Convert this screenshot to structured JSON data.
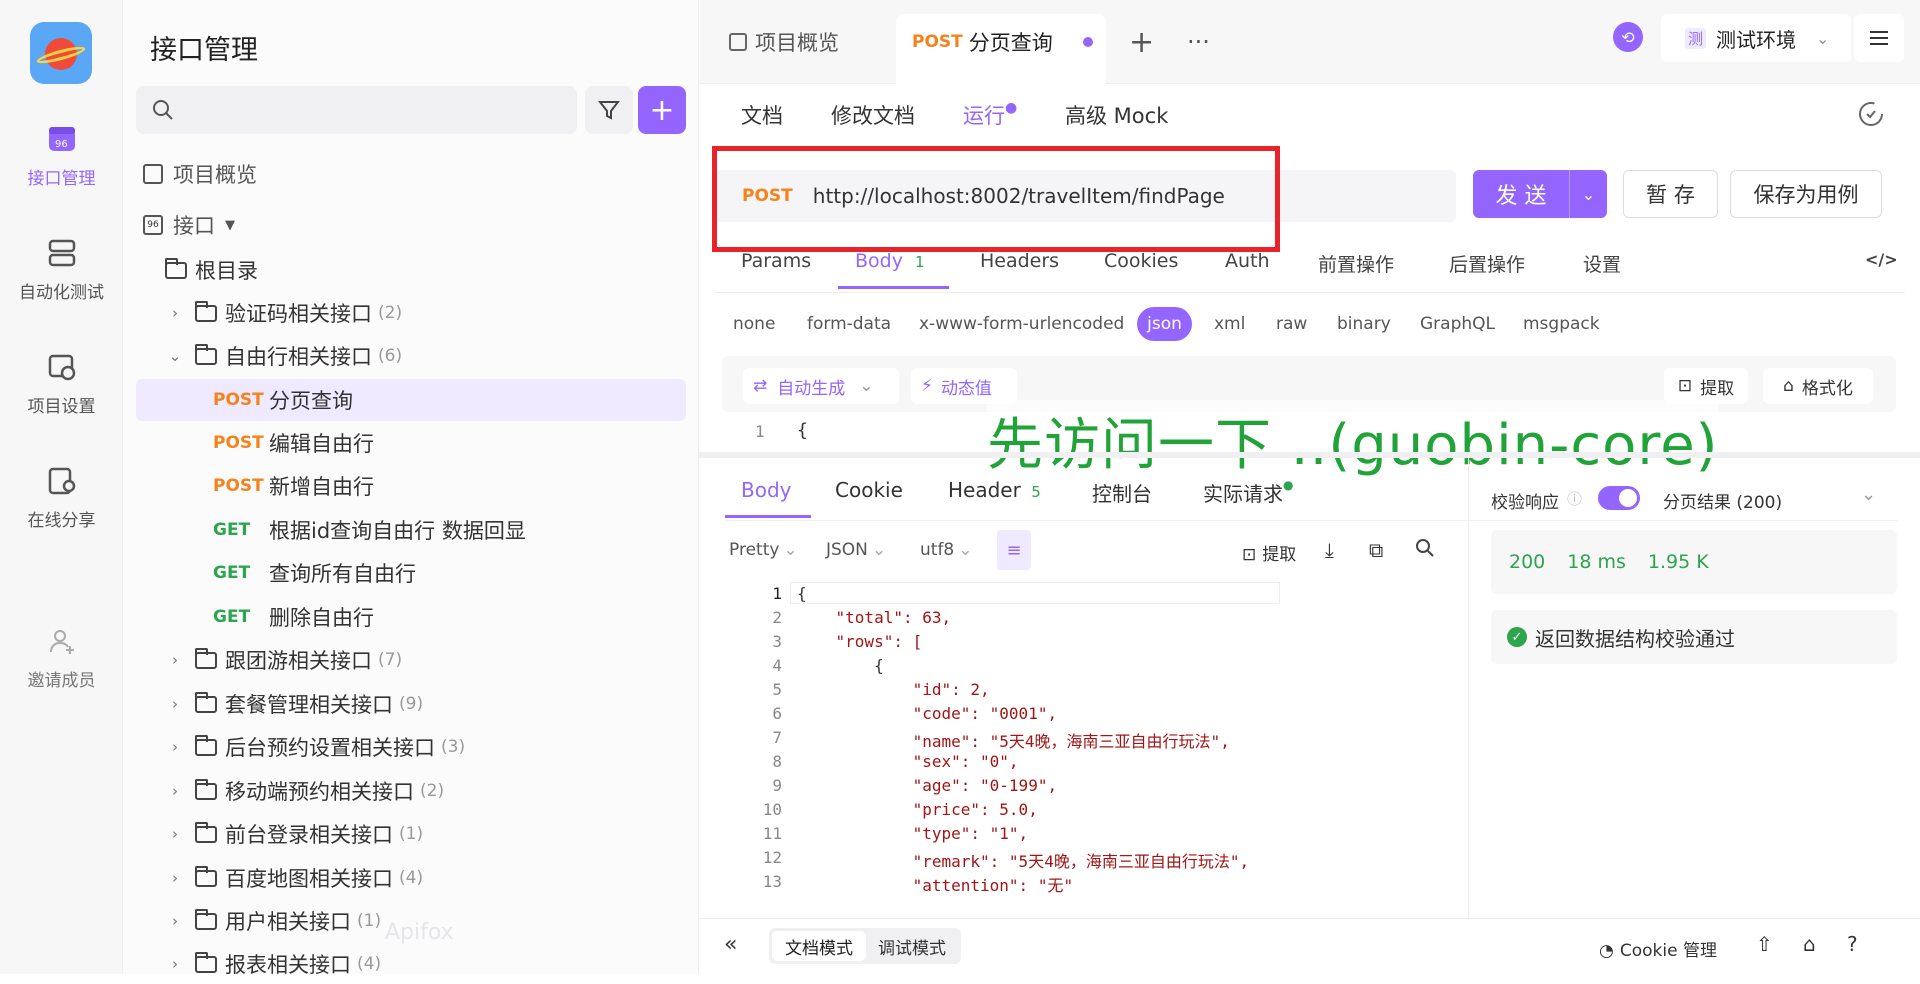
{
  "rail": {
    "items": [
      {
        "label": "接口管理",
        "icon": "api-icon",
        "active": true
      },
      {
        "label": "自动化测试",
        "icon": "automation-icon"
      },
      {
        "label": "项目设置",
        "icon": "settings-icon"
      },
      {
        "label": "在线分享",
        "icon": "share-icon"
      },
      {
        "label": "邀请成员",
        "icon": "add-user-icon"
      }
    ]
  },
  "sidebar": {
    "title": "接口管理",
    "overview": "项目概览",
    "interface": "接口",
    "root": "根目录",
    "folders": [
      {
        "name": "验证码相关接口",
        "count": "(2)"
      },
      {
        "name": "自由行相关接口",
        "count": "(6)"
      },
      {
        "name": "跟团游相关接口",
        "count": "(7)"
      },
      {
        "name": "套餐管理相关接口",
        "count": "(9)"
      },
      {
        "name": "后台预约设置相关接口",
        "count": "(3)"
      },
      {
        "name": "移动端预约相关接口",
        "count": "(2)"
      },
      {
        "name": "前台登录相关接口",
        "count": "(1)"
      },
      {
        "name": "百度地图相关接口",
        "count": "(4)"
      },
      {
        "name": "用户相关接口",
        "count": "(1)"
      },
      {
        "name": "报表相关接口",
        "count": "(4)"
      }
    ],
    "endpoints": [
      {
        "method": "POST",
        "name": "分页查询"
      },
      {
        "method": "POST",
        "name": "编辑自由行"
      },
      {
        "method": "POST",
        "name": "新增自由行"
      },
      {
        "method": "GET",
        "name": "根据id查询自由行 数据回显"
      },
      {
        "method": "GET",
        "name": "查询所有自由行"
      },
      {
        "method": "GET",
        "name": "删除自由行"
      }
    ],
    "watermark": "Apifox"
  },
  "topbar": {
    "tab1": "项目概览",
    "tab2_method": "POST",
    "tab2_name": "分页查询",
    "env_badge": "测",
    "env_name": "测试环境"
  },
  "subtabs": {
    "doc": "文档",
    "edit": "修改文档",
    "run": "运行",
    "mock": "高级 Mock"
  },
  "request": {
    "method": "POST",
    "url": "http://localhost:8002/travelItem/findPage",
    "send": "发 送",
    "save": "暂 存",
    "save_case": "保存为用例"
  },
  "body_tabs": [
    "Params",
    "Body",
    "Headers",
    "Cookies",
    "Auth",
    "前置操作",
    "后置操作",
    "设置"
  ],
  "body_count": "1",
  "content_types": [
    "none",
    "form-data",
    "x-www-form-urlencoded",
    "json",
    "xml",
    "raw",
    "binary",
    "GraphQL",
    "msgpack"
  ],
  "editor_tools": {
    "auto": "自动生成",
    "dynamic": "动态值",
    "extract": "提取",
    "format": "格式化",
    "first_line": "{"
  },
  "overlay": "先访问一下 ..(guobin-core)",
  "response": {
    "tabs": [
      "Body",
      "Cookie",
      "Header",
      "控制台",
      "实际请求"
    ],
    "header_count": "5",
    "pretty": "Pretty",
    "json": "JSON",
    "enc": "utf8",
    "extract": "提取",
    "lines": [
      "{",
      "    \"total\": 63,",
      "    \"rows\": [",
      "        {",
      "            \"id\": 2,",
      "            \"code\": \"0001\",",
      "            \"name\": \"5天4晚，海南三亚自由行玩法\",",
      "            \"sex\": \"0\",",
      "            \"age\": \"0-199\",",
      "            \"price\": 5.0,",
      "            \"type\": \"1\",",
      "            \"remark\": \"5天4晚，海南三亚自由行玩法\",",
      "            \"attention\": \"无\""
    ]
  },
  "validation": {
    "label": "校验响应",
    "result": "分页结果 (200)",
    "status": "200",
    "time": "18 ms",
    "size": "1.95 K",
    "message": "返回数据结构校验通过"
  },
  "footer": {
    "doc_mode": "文档模式",
    "debug_mode": "调试模式",
    "cookie": "Cookie 管理"
  },
  "colors": {
    "accent": "#9466ff",
    "post": "#f7821b",
    "get": "#2da44e",
    "highlight": "#e8232a",
    "overlay": "#22a33a"
  }
}
